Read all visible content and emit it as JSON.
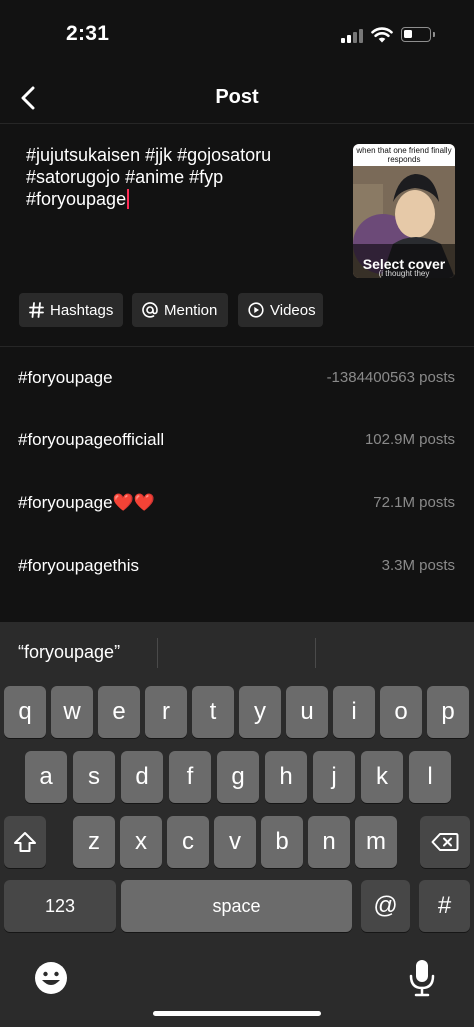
{
  "status": {
    "time": "2:31"
  },
  "header": {
    "title": "Post"
  },
  "caption": {
    "lines": [
      "#jujutsukaisen #jjk #gojosatoru",
      "#satorugojo #anime #fyp",
      "#foryoupage"
    ]
  },
  "cover": {
    "overlay_text": "when that one friend finally responds",
    "bottom_text": "(i thought they",
    "label": "Select cover"
  },
  "chips": [
    {
      "label": "Hashtags",
      "icon": "hash-icon"
    },
    {
      "label": "Mention",
      "icon": "at-icon"
    },
    {
      "label": "Videos",
      "icon": "play-circle-icon"
    }
  ],
  "suggestions": [
    {
      "tag": "#foryoupage",
      "count": "-1384400563 posts"
    },
    {
      "tag": "#foryoupageofficiall",
      "count": "102.9M posts"
    },
    {
      "tag": "#foryoupage❤️❤️",
      "count": "72.1M posts"
    },
    {
      "tag": "#foryoupagethis",
      "count": "3.3M posts"
    }
  ],
  "keyboard": {
    "prediction": "“foryoupage”",
    "row1": [
      "q",
      "w",
      "e",
      "r",
      "t",
      "y",
      "u",
      "i",
      "o",
      "p"
    ],
    "row2": [
      "a",
      "s",
      "d",
      "f",
      "g",
      "h",
      "j",
      "k",
      "l"
    ],
    "row3": [
      "z",
      "x",
      "c",
      "v",
      "b",
      "n",
      "m"
    ],
    "numbers_label": "123",
    "space_label": "space",
    "at_label": "@",
    "hash_label": "#"
  },
  "colors": {
    "cursor": "#fe2c55",
    "background": "#121212",
    "muted": "#8a8a8a"
  }
}
